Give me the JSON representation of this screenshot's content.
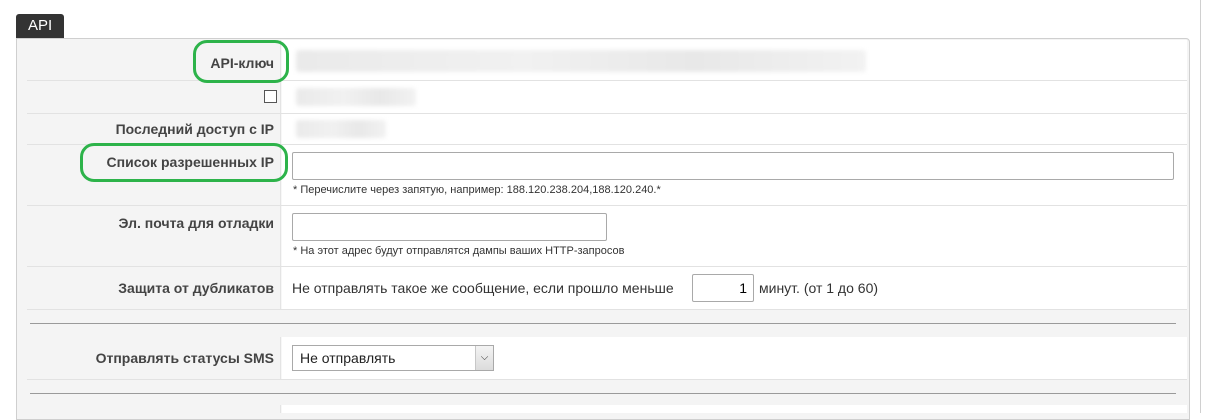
{
  "tab": {
    "label": "API"
  },
  "fields": {
    "api_key": {
      "label": "API-ключ"
    },
    "last_ip": {
      "label": "Последний доступ с IP"
    },
    "allowed_ip": {
      "label": "Список разрешенных IP",
      "value": "",
      "hint": "* Перечислите через запятую, например: 188.120.238.204,188.120.240.*"
    },
    "debug_email": {
      "label": "Эл. почта для отладки",
      "value": "",
      "hint": "* На этот адрес будут отправлятся дампы ваших HTTP-запросов"
    },
    "duplicates": {
      "label": "Защита от дубликатов",
      "prefix": "Не отправлять такое же сообщение, если прошло меньше",
      "value": "1",
      "suffix": "минут. (от 1 до 60)"
    },
    "sms_status": {
      "label": "Отправлять статусы SMS",
      "selected": "Не отправлять"
    }
  },
  "colors": {
    "highlight": "#2db34a",
    "tab_bg": "#333333"
  }
}
